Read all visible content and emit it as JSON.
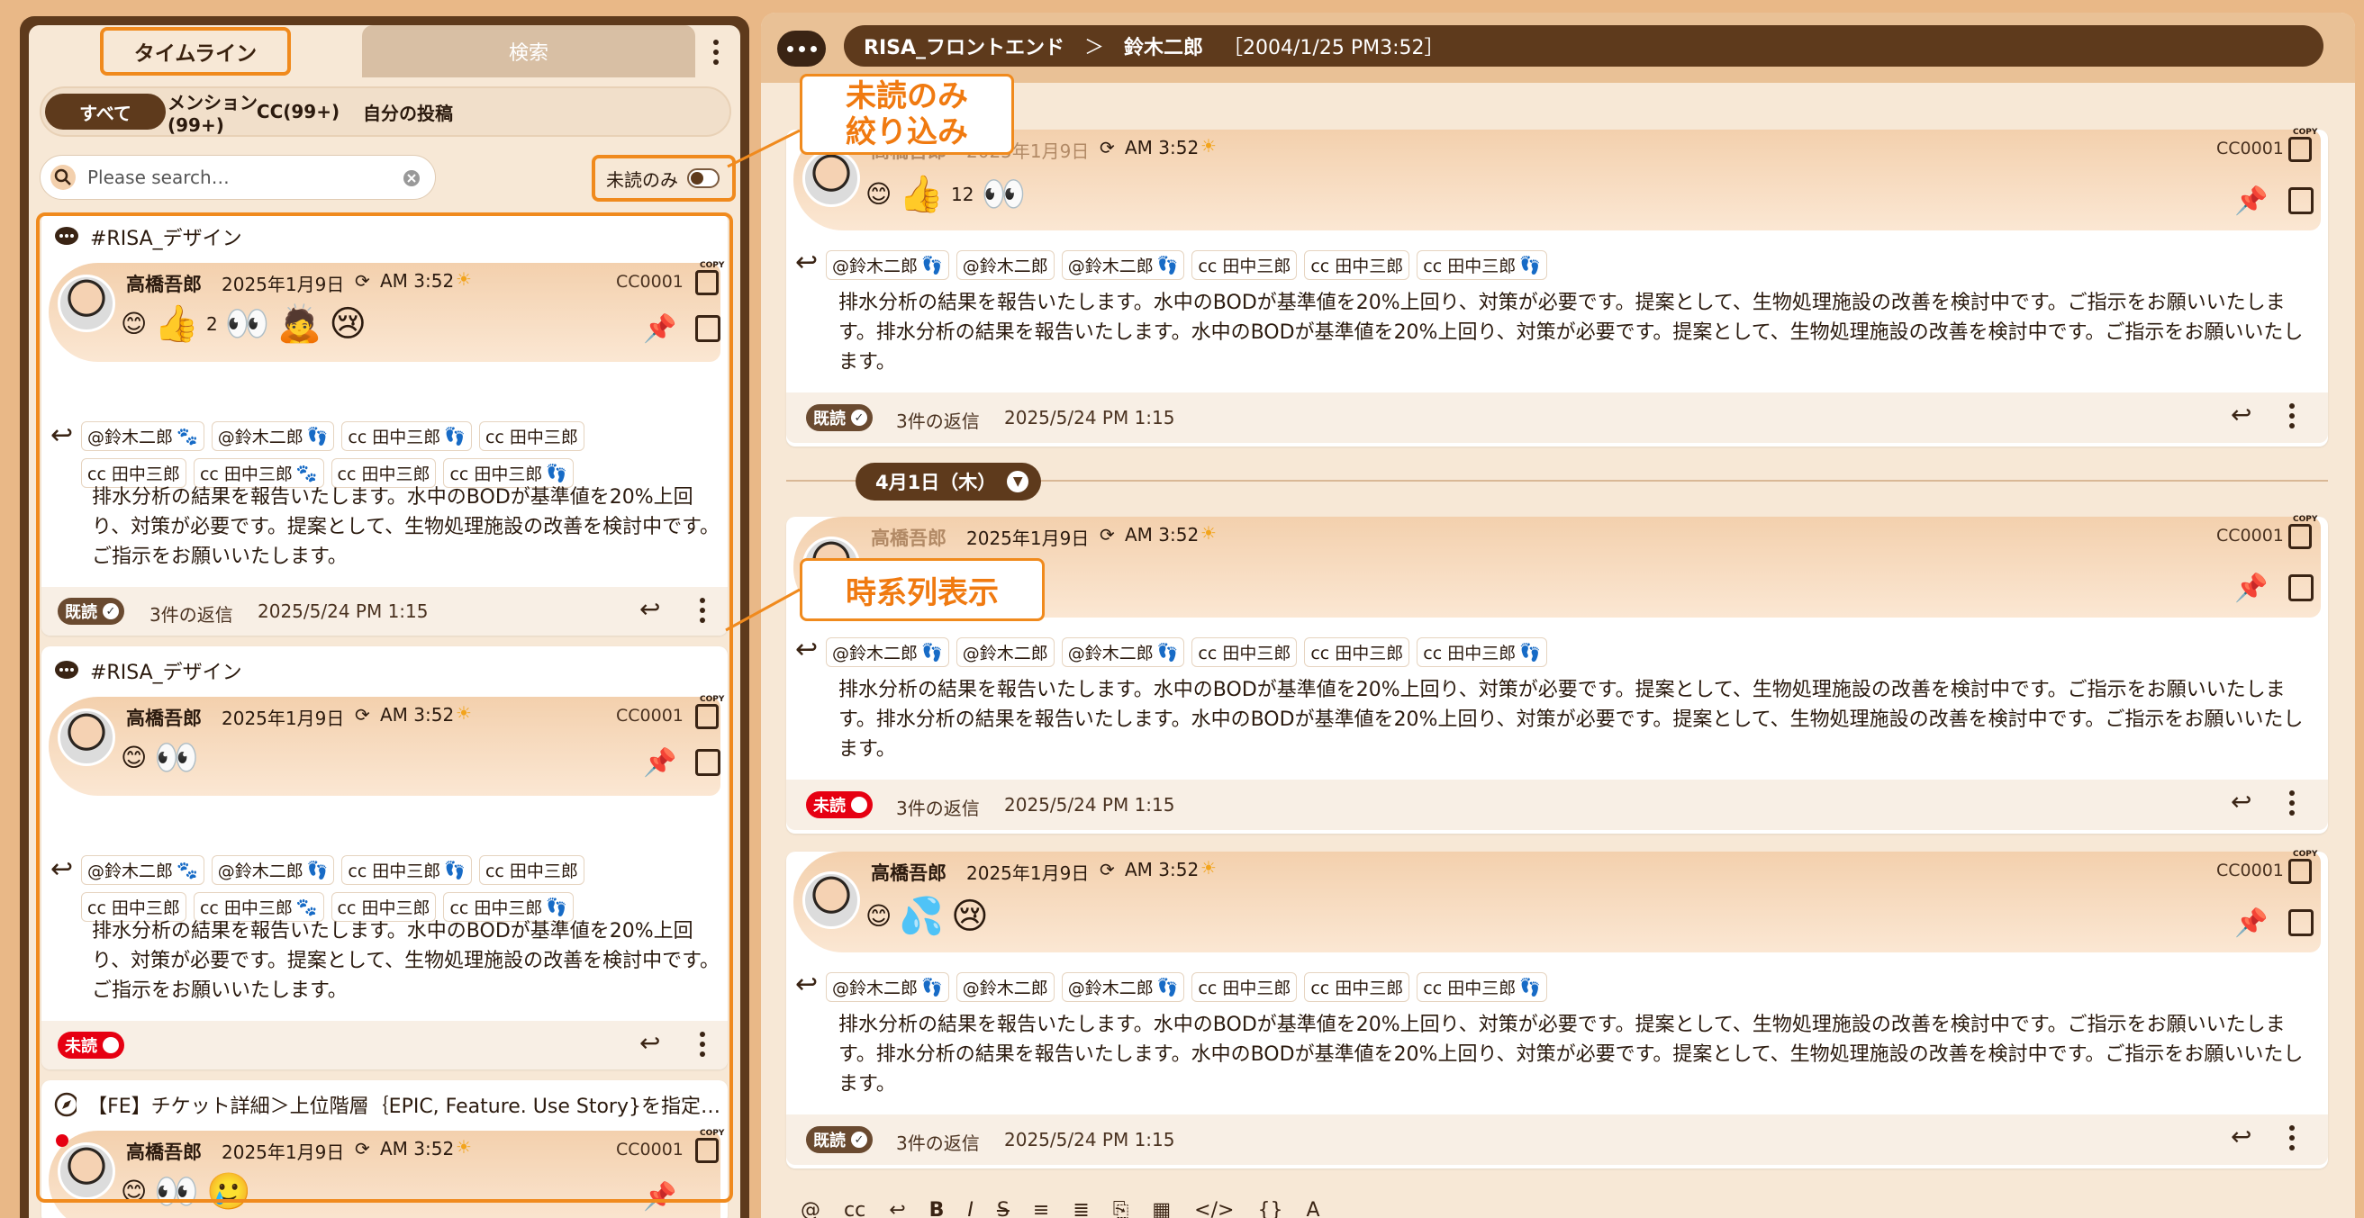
{
  "left": {
    "tabs": {
      "timeline": "タイムライン",
      "search": "検索"
    },
    "filters": [
      "すべて",
      "メンション(99+)",
      "CC(99+)",
      "自分の投稿"
    ],
    "search_placeholder": "Please search…",
    "unread_only_label": "未読のみ",
    "cards": [
      {
        "channel": "#RISA_デザイン",
        "author": "高橋吾郎",
        "date": "2025年1月9日",
        "time": "AM 3:52",
        "cc": "CC0001",
        "copy": "COPY",
        "reaction_count": "2",
        "mentions": [
          "@鈴木二郎",
          "@鈴木二郎",
          "cc 田中三郎",
          "cc 田中三郎",
          "cc 田中三郎",
          "cc 田中三郎",
          "cc 田中三郎",
          "cc 田中三郎"
        ],
        "body": "排水分析の結果を報告いたします。水中のBODが基準値を20%上回り、対策が必要です。提案として、生物処理施設の改善を検討中です。ご指示をお願いいたします。",
        "status": "既読",
        "replies": "3件の返信",
        "reply_time": "2025/5/24 PM 1:15"
      },
      {
        "channel": "#RISA_デザイン",
        "author": "高橋吾郎",
        "date": "2025年1月9日",
        "time": "AM 3:52",
        "cc": "CC0001",
        "copy": "COPY",
        "mentions": [
          "@鈴木二郎",
          "@鈴木二郎",
          "cc 田中三郎",
          "cc 田中三郎",
          "cc 田中三郎",
          "cc 田中三郎",
          "cc 田中三郎",
          "cc 田中三郎"
        ],
        "body": "排水分析の結果を報告いたします。水中のBODが基準値を20%上回り、対策が必要です。提案として、生物処理施設の改善を検討中です。ご指示をお願いいたします。",
        "status": "未読"
      },
      {
        "channel": "【FE】チケット詳細＞上位階層｛EPIC, Feature. Use Story}を指定…",
        "author": "高橋吾郎",
        "date": "2025年1月9日",
        "time": "AM 3:52",
        "cc": "CC0001",
        "copy": "COPY"
      }
    ]
  },
  "callouts": {
    "unread_filter": "未読のみ\n絞り込み",
    "chronological": "時系列表示"
  },
  "right": {
    "breadcrumb": {
      "channel": "RISA_フロントエンド",
      "sep": "＞",
      "user": "鈴木二郎",
      "timestamp": "［2004/1/25 PM3:52］"
    },
    "day_separator": "4月1日（木）",
    "messages": [
      {
        "author": "高橋吾郎",
        "date": "2025年1月9日",
        "time": "AM 3:52",
        "cc": "CC0001",
        "copy": "COPY",
        "reaction_count": "12",
        "mentions": [
          "@鈴木二郎",
          "@鈴木二郎",
          "@鈴木二郎",
          "cc 田中三郎",
          "cc 田中三郎",
          "cc 田中三郎"
        ],
        "body": "排水分析の結果を報告いたします。水中のBODが基準値を20%上回り、対策が必要です。提案として、生物処理施設の改善を検討中です。ご指示をお願いいたします。排水分析の結果を報告いたします。水中のBODが基準値を20%上回り、対策が必要です。提案として、生物処理施設の改善を検討中です。ご指示をお願いいたします。",
        "status": "既読",
        "replies": "3件の返信",
        "reply_time": "2025/5/24 PM 1:15"
      },
      {
        "author": "高橋吾郎",
        "date": "2025年1月9日",
        "time": "AM 3:52",
        "cc": "CC0001",
        "copy": "COPY",
        "mentions": [
          "@鈴木二郎",
          "@鈴木二郎",
          "@鈴木二郎",
          "cc 田中三郎",
          "cc 田中三郎",
          "cc 田中三郎"
        ],
        "body": "排水分析の結果を報告いたします。水中のBODが基準値を20%上回り、対策が必要です。提案として、生物処理施設の改善を検討中です。ご指示をお願いいたします。排水分析の結果を報告いたします。水中のBODが基準値を20%上回り、対策が必要です。提案として、生物処理施設の改善を検討中です。ご指示をお願いいたします。",
        "status": "未読",
        "replies": "3件の返信",
        "reply_time": "2025/5/24 PM 1:15"
      },
      {
        "author": "高橋吾郎",
        "date": "2025年1月9日",
        "time": "AM 3:52",
        "cc": "CC0001",
        "copy": "COPY",
        "mentions": [
          "@鈴木二郎",
          "@鈴木二郎",
          "@鈴木二郎",
          "cc 田中三郎",
          "cc 田中三郎",
          "cc 田中三郎"
        ],
        "body": "排水分析の結果を報告いたします。水中のBODが基準値を20%上回り、対策が必要です。提案として、生物処理施設の改善を検討中です。ご指示をお願いいたします。排水分析の結果を報告いたします。水中のBODが基準値を20%上回り、対策が必要です。提案として、生物処理施設の改善を検討中です。ご指示をお願いいたします。",
        "status": "既読",
        "replies": "3件の返信",
        "reply_time": "2025/5/24 PM 1:15"
      }
    ]
  },
  "colors": {
    "accent": "#f08a1d",
    "brown": "#5e3a1c",
    "unread": "#e60012",
    "bg": "#e9b887"
  }
}
